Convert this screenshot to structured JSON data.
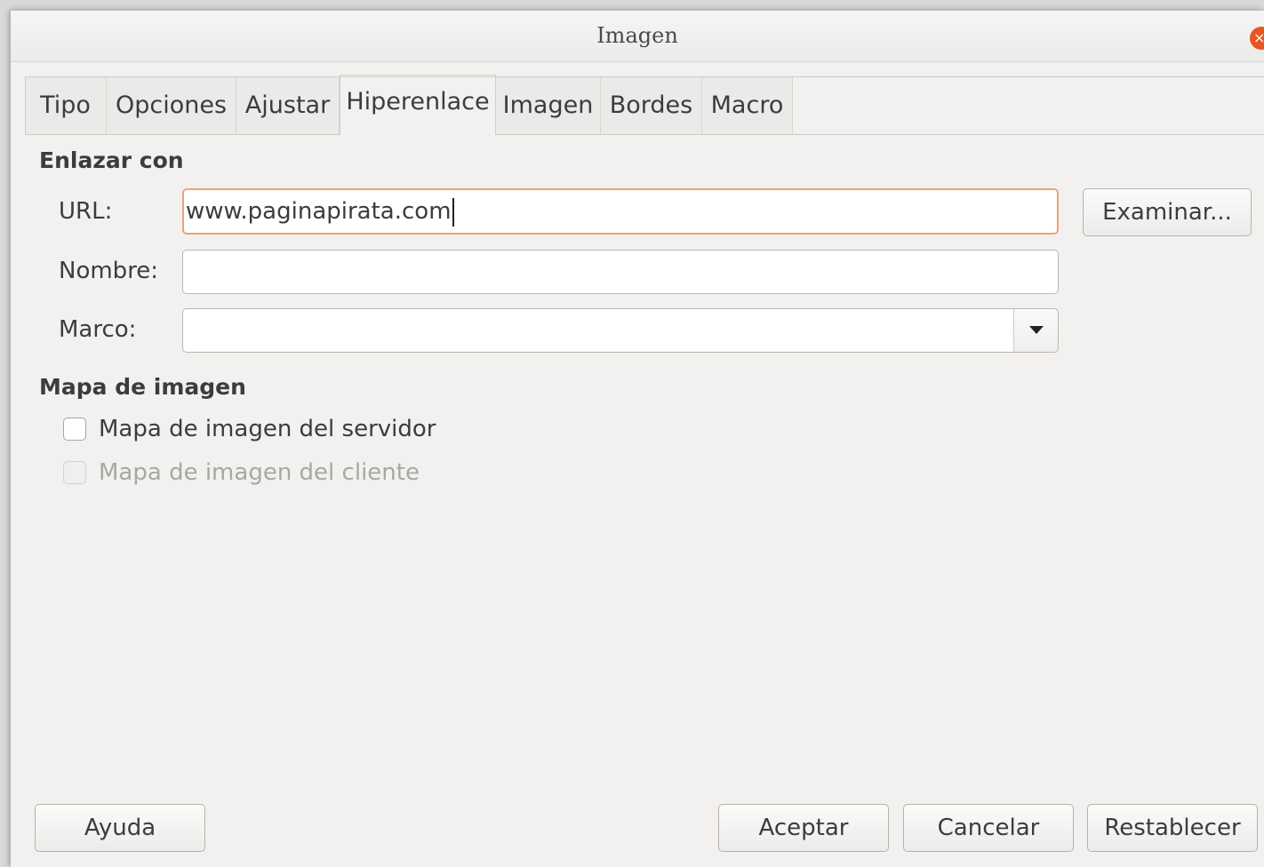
{
  "window": {
    "title": "Imagen",
    "close_symbol": "×",
    "accent_color": "#e95420"
  },
  "tabs": [
    {
      "label": "Tipo",
      "active": false
    },
    {
      "label": "Opciones",
      "active": false
    },
    {
      "label": "Ajustar",
      "active": false
    },
    {
      "label": "Hiperenlace",
      "active": true
    },
    {
      "label": "Imagen",
      "active": false
    },
    {
      "label": "Bordes",
      "active": false
    },
    {
      "label": "Macro",
      "active": false
    }
  ],
  "link_section": {
    "heading": "Enlazar con",
    "url_label": "URL:",
    "url_value": "www.paginapirata.com",
    "name_label": "Nombre:",
    "name_value": "",
    "frame_label": "Marco:",
    "frame_value": "",
    "browse_button": "Examinar..."
  },
  "image_map_section": {
    "heading": "Mapa de imagen",
    "server_map_label": "Mapa de imagen del servidor",
    "server_map_checked": false,
    "client_map_label": "Mapa de imagen del cliente",
    "client_map_checked": false,
    "client_map_enabled": false
  },
  "footer": {
    "help_button": "Ayuda",
    "ok_button": "Aceptar",
    "cancel_button": "Cancelar",
    "reset_button": "Restablecer"
  },
  "icons": {
    "dropdown": "chevron-down-icon",
    "close": "close-icon"
  }
}
